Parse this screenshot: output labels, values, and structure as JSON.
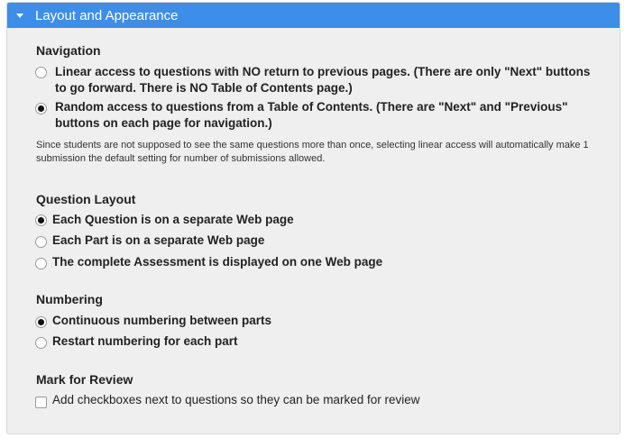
{
  "header": {
    "title": "Layout and Appearance"
  },
  "navigation": {
    "title": "Navigation",
    "options": [
      {
        "label": " Linear access to questions with NO return to previous pages. (There are only \"Next\" buttons to go forward. There is NO Table of Contents page.)",
        "selected": false
      },
      {
        "label": " Random access to questions from a Table of Contents. (There are \"Next\" and \"Previous\" buttons on each page for navigation.)",
        "selected": true
      }
    ],
    "note": "Since students are not supposed to see the same questions more than once, selecting linear access will automatically make 1 submission the default setting for number of submissions allowed."
  },
  "question_layout": {
    "title": "Question Layout",
    "options": [
      {
        "label": "Each Question is on a separate Web page",
        "selected": true
      },
      {
        "label": "Each Part is on a separate Web page",
        "selected": false
      },
      {
        "label": "The complete Assessment is displayed on one Web page",
        "selected": false
      }
    ]
  },
  "numbering": {
    "title": "Numbering",
    "options": [
      {
        "label": "Continuous numbering between parts",
        "selected": true
      },
      {
        "label": "Restart numbering for each part",
        "selected": false
      }
    ]
  },
  "mark_for_review": {
    "title": "Mark for Review",
    "checkbox": {
      "label": "Add checkboxes next to questions so they can be marked for review",
      "checked": false
    }
  }
}
